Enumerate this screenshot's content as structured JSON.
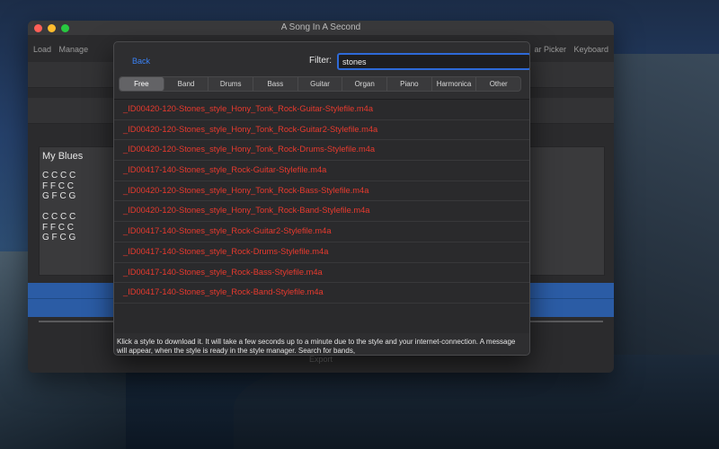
{
  "window": {
    "title": "A Song In A Second",
    "toolbar_left": [
      "Load",
      "Manage"
    ],
    "toolbar_right": [
      "ar Picker",
      "Keyboard"
    ],
    "export_label": "Export"
  },
  "song": {
    "title": "My Blues",
    "chords": "C C C C\nF F C C\nG F C G\n\nC C C C\nF F C C\nG F C G"
  },
  "dialog": {
    "back_label": "Back",
    "filter_label": "Filter:",
    "filter_value": "stones",
    "categories": [
      "Free",
      "Band",
      "Drums",
      "Bass",
      "Guitar",
      "Organ",
      "Piano",
      "Harmonica",
      "Other"
    ],
    "active_category": "Free",
    "files": [
      "_ID00420-120-Stones_style_Hony_Tonk_Rock-Guitar-Stylefile.m4a",
      "_ID00420-120-Stones_style_Hony_Tonk_Rock-Guitar2-Stylefile.m4a",
      "_ID00420-120-Stones_style_Hony_Tonk_Rock-Drums-Stylefile.m4a",
      "_ID00417-140-Stones_style_Rock-Guitar-Stylefile.m4a",
      "_ID00420-120-Stones_style_Hony_Tonk_Rock-Bass-Stylefile.m4a",
      "_ID00420-120-Stones_style_Hony_Tonk_Rock-Band-Stylefile.m4a",
      "_ID00417-140-Stones_style_Rock-Guitar2-Stylefile.m4a",
      "_ID00417-140-Stones_style_Rock-Drums-Stylefile.m4a",
      "_ID00417-140-Stones_style_Rock-Bass-Stylefile.m4a",
      "_ID00417-140-Stones_style_Rock-Band-Stylefile.m4a"
    ],
    "info_text": "Klick a style to download it.  It will take a few seconds up to a minute due to the style and your internet-connection. A message will appear, when the style is ready in the style manager. Search for bands,"
  },
  "colors": {
    "accent": "#3a82f6",
    "file_text": "#e83a2e",
    "blue_band": "#2b5ca5"
  }
}
